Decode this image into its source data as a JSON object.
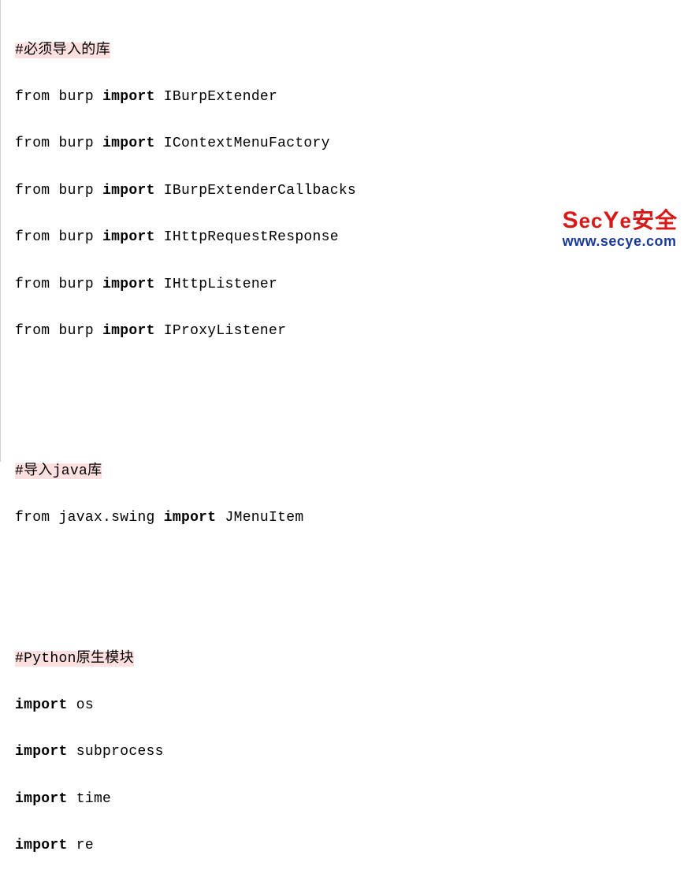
{
  "comments": {
    "section1": "#必须导入的库",
    "section2": "#导入java库",
    "section3": "#Python原生模块"
  },
  "imports": {
    "burp": [
      {
        "from": "burp",
        "name": "IBurpExtender"
      },
      {
        "from": "burp",
        "name": "IContextMenuFactory"
      },
      {
        "from": "burp",
        "name": "IBurpExtenderCallbacks"
      },
      {
        "from": "burp",
        "name": "IHttpRequestResponse"
      },
      {
        "from": "burp",
        "name": "IHttpListener"
      },
      {
        "from": "burp",
        "name": "IProxyListener"
      }
    ],
    "java": [
      {
        "from": "javax.swing",
        "name": "JMenuItem"
      }
    ],
    "python": [
      {
        "name": "os"
      },
      {
        "name": "subprocess"
      },
      {
        "name": "time"
      },
      {
        "name": "re"
      }
    ]
  },
  "keywords": {
    "from": "from",
    "import": "import"
  },
  "watermark": {
    "title_part1": "S",
    "title_part2": "ec",
    "title_part3": "Y",
    "title_part4": "e",
    "title_cn": "安全",
    "url": "www.secye.com"
  }
}
